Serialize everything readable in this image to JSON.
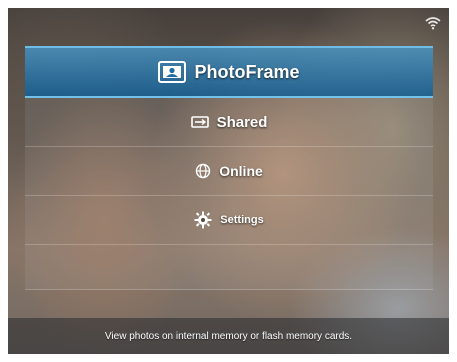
{
  "menu": {
    "items": [
      {
        "label": "PhotoFrame",
        "icon": "photo-frame-icon",
        "selected": true
      },
      {
        "label": "Shared",
        "icon": "shared-icon",
        "selected": false
      },
      {
        "label": "Online",
        "icon": "globe-icon",
        "selected": false
      },
      {
        "label": "Settings",
        "icon": "gear-icon",
        "selected": false
      }
    ]
  },
  "status": {
    "help_text": "View photos on internal memory or flash memory cards.",
    "wifi_icon": "wifi-icon"
  },
  "colors": {
    "highlight": "#1f6ea3",
    "text": "#ffffff"
  }
}
